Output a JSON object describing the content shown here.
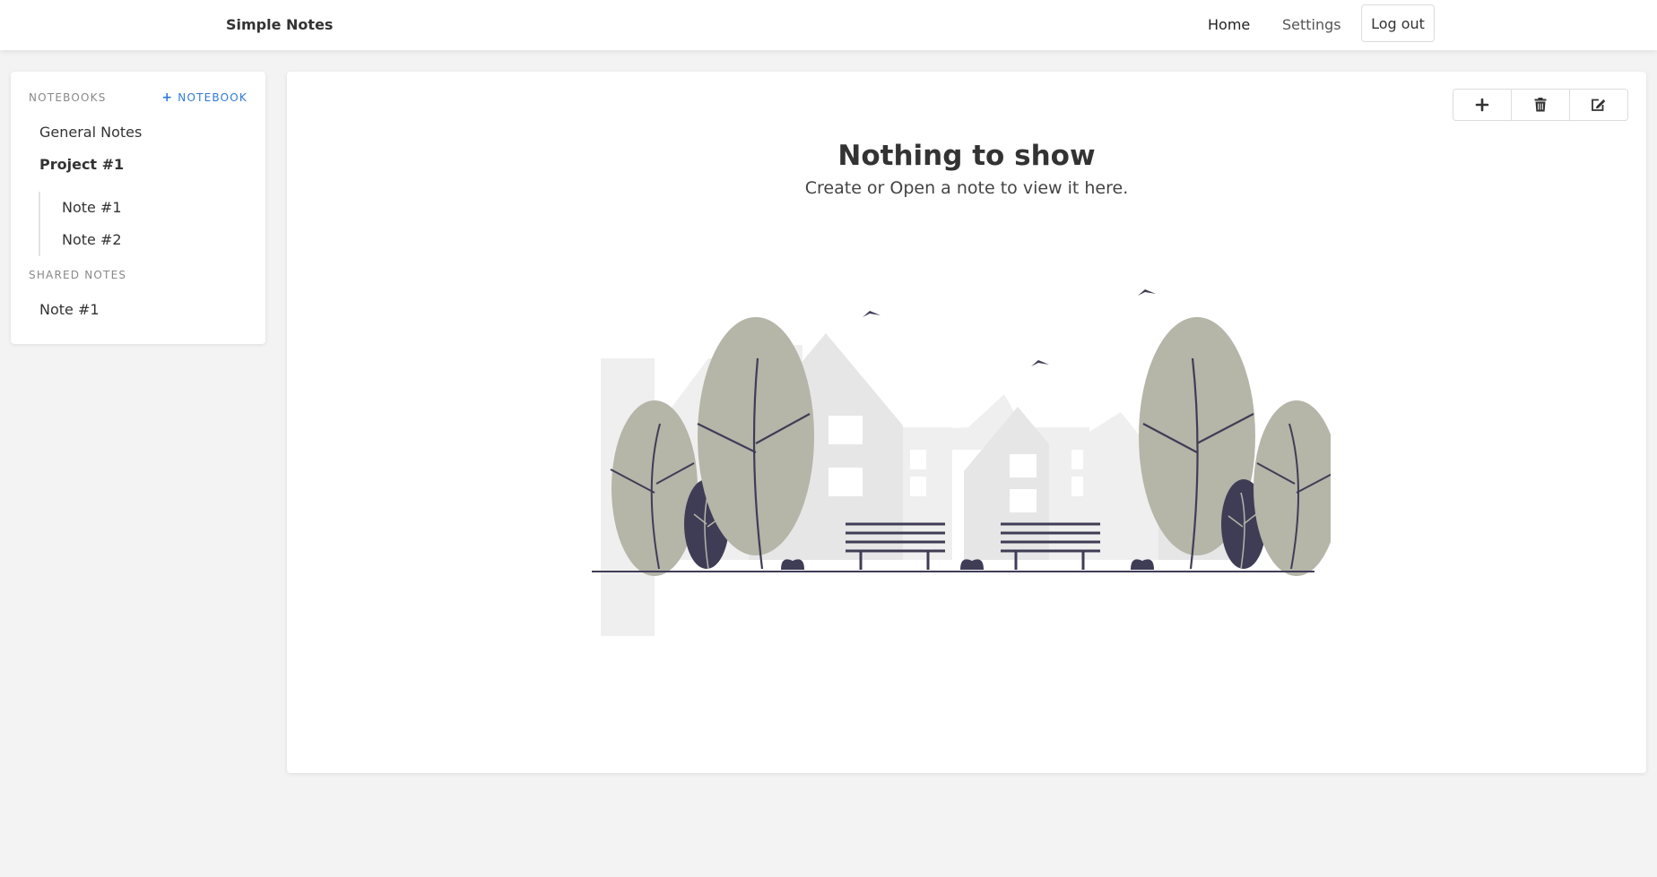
{
  "app": {
    "title": "Simple Notes"
  },
  "nav": {
    "home": "Home",
    "settings": "Settings",
    "logout": "Log out"
  },
  "sidebar": {
    "notebooks_label": "NOTEBOOKS",
    "add_notebook_plus": "+",
    "add_notebook_label": "NOTEBOOK",
    "notebooks": [
      {
        "label": "General Notes"
      },
      {
        "label": "Project #1",
        "notes": [
          {
            "label": "Note #1"
          },
          {
            "label": "Note #2"
          }
        ]
      }
    ],
    "shared_label": "SHARED NOTES",
    "shared": [
      {
        "label": "Note #1"
      }
    ]
  },
  "main": {
    "empty_title": "Nothing to show",
    "empty_subtitle": "Create or Open a note to view it here.",
    "toolbar": [
      "plus-icon",
      "trash-icon",
      "edit-icon"
    ]
  },
  "colors": {
    "accent": "#2f7bd6",
    "illustration_dark": "#3f3d56",
    "tree": "#b5b5a8",
    "building": "#e6e6e6"
  }
}
